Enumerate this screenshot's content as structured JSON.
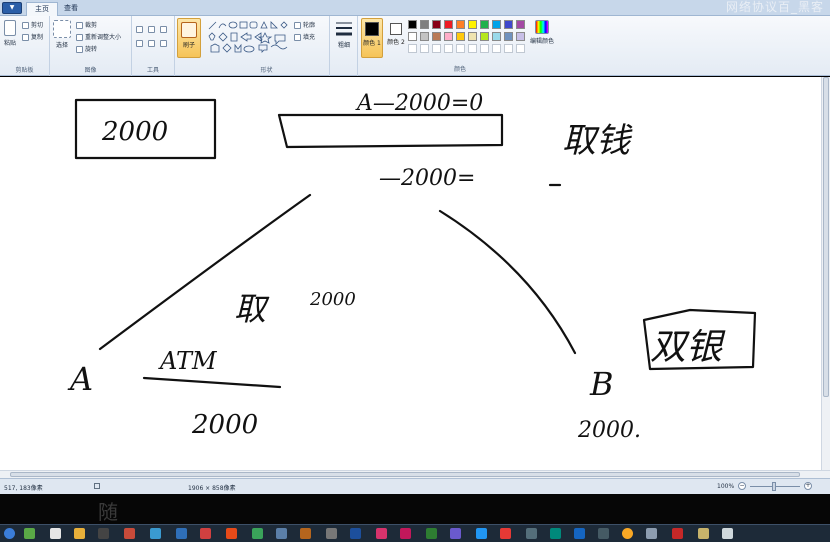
{
  "window": {
    "app_menu_label": "▼",
    "tabs": [
      {
        "label": "主页"
      },
      {
        "label": "查看"
      }
    ],
    "title_fragment": "网络协议百_黑客"
  },
  "ribbon": {
    "clipboard": {
      "paste": "粘贴",
      "cut": "剪切",
      "copy": "复制",
      "label": "剪贴板"
    },
    "image": {
      "select": "选择",
      "crop": "裁剪",
      "resize": "重新调整大小",
      "rotate": "旋转",
      "label": "图像"
    },
    "tools": {
      "label": "工具"
    },
    "brush": {
      "label": "刷子"
    },
    "shapes": {
      "outline": "轮廓",
      "fill": "填充",
      "label": "形状"
    },
    "size": {
      "label": "粗细"
    },
    "colors": {
      "color1": "颜色 1",
      "color2": "颜色 2",
      "edit": "编辑颜色",
      "label": "颜色",
      "palette_row1": [
        "#000000",
        "#7f7f7f",
        "#880015",
        "#ed1c24",
        "#ff7f27",
        "#fff200",
        "#22b14c",
        "#00a2e8",
        "#3f48cc",
        "#a349a4"
      ],
      "palette_row2": [
        "#ffffff",
        "#c3c3c3",
        "#b97a57",
        "#ffaec9",
        "#ffc90e",
        "#efe4b0",
        "#b5e61d",
        "#99d9ea",
        "#7092be",
        "#c8bfe7"
      ],
      "color1_value": "#000000",
      "color2_value": "#ffffff"
    }
  },
  "canvas": {
    "sketch": {
      "top_right_chars": "取钱",
      "right_box_chars": "双银",
      "middle_chars": "取",
      "label_a": "A",
      "label_b": "B",
      "atm_text": "ATM",
      "top_box_text": "2000",
      "header_text": "A—2000=0",
      "minus_text": "—2000=",
      "middle_amount": "2000",
      "amount_under_atm": "2000",
      "amount_b": "2000."
    }
  },
  "status": {
    "cursor_pos": "517, 183像素",
    "canvas_size": "1906 × 858像素",
    "zoom": "100%",
    "zoom_minus": "−",
    "zoom_plus": "+"
  },
  "background": {
    "band_char": "随"
  }
}
